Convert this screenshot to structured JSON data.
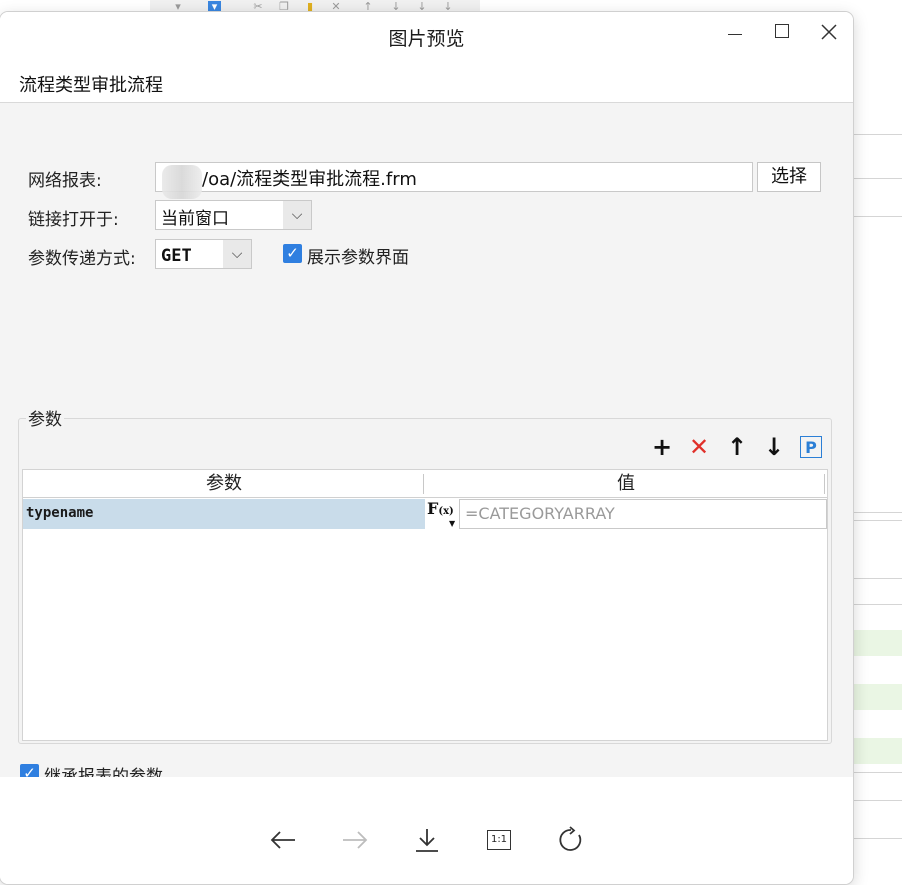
{
  "viewer": {
    "title": "图片预览",
    "controls": {
      "minimize": "minimize-icon",
      "maximize": "maximize-icon",
      "close": "close-icon"
    },
    "toolbar": [
      "arrow-left-icon",
      "arrow-right-icon",
      "download-icon",
      "actual-size-icon",
      "rotate-icon"
    ],
    "actual_size_label": "1:1"
  },
  "dialog": {
    "header": "流程类型审批流程",
    "web_report_label": "网络报表:",
    "web_report_value": "/oa/流程类型审批流程.frm",
    "choose_button": "选择",
    "open_in_label": "链接打开于:",
    "open_in_value": "当前窗口",
    "param_method_label": "参数传递方式:",
    "param_method_value": "GET",
    "show_param_ui_label": "展示参数界面",
    "show_param_ui_checked": true,
    "params_group_title": "参数",
    "params_tools": [
      "add-icon",
      "delete-icon",
      "move-up-icon",
      "move-down-icon",
      "param-p-icon"
    ],
    "param_p_label": "P",
    "table": {
      "headers": [
        "参数",
        "值"
      ],
      "rows": [
        {
          "name": "typename",
          "fx": "F",
          "fx_sub": "(x)",
          "value": "=CATEGORYARRAY"
        }
      ]
    },
    "inherit_label": "继承报表的参数",
    "inherit_checked": true
  },
  "colors": {
    "accent": "#2f7fe0",
    "delete": "#e0302a",
    "selected_row": "#c9dcea"
  }
}
